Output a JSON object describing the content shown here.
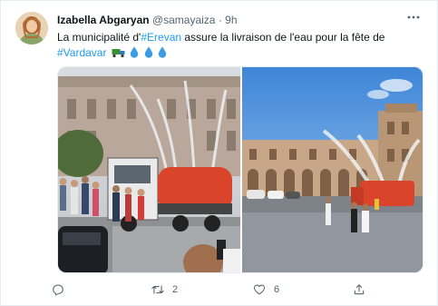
{
  "tweet": {
    "author_name": "Izabella Abgaryan",
    "author_handle": "@samayaiza",
    "separator": "·",
    "time": "9h",
    "text_part1": "La municipalité d'",
    "hashtag1": "#Erevan",
    "text_part2": " assure la livraison de l'eau pour la fête de",
    "hashtag2": "#Vardavar",
    "emojis": [
      "truck-emoji",
      "droplet-emoji",
      "droplet-emoji",
      "droplet-emoji"
    ],
    "more_icon": "more-icon"
  },
  "actions": {
    "reply": {
      "icon": "reply-icon",
      "count": ""
    },
    "retweet": {
      "icon": "retweet-icon",
      "count": "2"
    },
    "like": {
      "icon": "heart-icon",
      "count": "6"
    },
    "share": {
      "icon": "share-icon",
      "count": ""
    }
  },
  "colors": {
    "accent": "#1d9bf0",
    "text": "#0f1419",
    "muted": "#536471",
    "border": "#e6ecf0",
    "truck_tank": "#d9442a"
  }
}
